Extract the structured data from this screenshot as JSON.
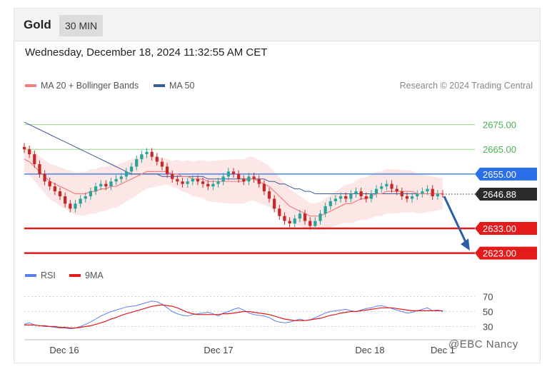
{
  "header": {
    "asset": "Gold",
    "timeframe": "30 MIN"
  },
  "datetime": "Wednesday, December 18, 2024 11:32:55 AM CET",
  "legend": {
    "ma20_label": "MA 20 + Bollinger Bands",
    "ma50_label": "MA 50"
  },
  "credit": "Research © 2024 Trading Central",
  "rsi_legend": {
    "rsi_label": "RSI",
    "ma9_label": "9MA"
  },
  "watermark": "@EBC Nancy",
  "colors": {
    "up": "#26a69a",
    "down": "#c62828",
    "ma20": "#f08080",
    "band": "#fcd5d5",
    "ma50": "#3d5a99",
    "green_level": "#9ad58a",
    "blue_level": "#2a6ee8",
    "red_level": "#e31b1b",
    "price_tag": "#2b2b2b",
    "rsi": "#5b7ff0",
    "rsi_ma": "#e31b1b",
    "arrow": "#2e5ea8"
  },
  "chart_data": [
    {
      "type": "candlestick",
      "title": "Gold",
      "x_ticks": [
        "Dec 16",
        "Dec 17",
        "Dec 18",
        "Dec 1"
      ],
      "y_range": [
        2620,
        2685
      ],
      "last_price": 2646.88,
      "levels": [
        {
          "value": 2675.0,
          "label": "2675.00",
          "kind": "resistance-green"
        },
        {
          "value": 2665.0,
          "label": "2665.00",
          "kind": "resistance-green"
        },
        {
          "value": 2655.0,
          "label": "2655.00",
          "kind": "pivot-blue"
        },
        {
          "value": 2633.0,
          "label": "2633.00",
          "kind": "target-red"
        },
        {
          "value": 2623.0,
          "label": "2623.00",
          "kind": "target-red"
        }
      ],
      "last_price_label": "2646.88",
      "close_series": [
        2665,
        2663,
        2659,
        2655,
        2652,
        2650,
        2648,
        2646,
        2643,
        2641,
        2643,
        2645,
        2646,
        2648,
        2650,
        2651,
        2650,
        2652,
        2653,
        2654,
        2656,
        2658,
        2661,
        2663,
        2664,
        2662,
        2660,
        2658,
        2655,
        2653,
        2652,
        2651,
        2652,
        2653,
        2652,
        2651,
        2650,
        2651,
        2652,
        2654,
        2656,
        2655,
        2653,
        2652,
        2654,
        2653,
        2651,
        2648,
        2645,
        2641,
        2638,
        2636,
        2635,
        2637,
        2639,
        2636,
        2634,
        2636,
        2639,
        2642,
        2644,
        2645,
        2646,
        2645,
        2647,
        2648,
        2646,
        2645,
        2647,
        2649,
        2650,
        2651,
        2649,
        2648,
        2646,
        2645,
        2646,
        2647,
        2648,
        2649,
        2646,
        2647,
        2646.88
      ],
      "ma20_series": [
        2661,
        2660,
        2658,
        2656,
        2654,
        2652,
        2651,
        2650,
        2649,
        2648,
        2647,
        2647,
        2647,
        2648,
        2648,
        2649,
        2649,
        2650,
        2650,
        2651,
        2652,
        2653,
        2654,
        2655,
        2656,
        2656,
        2656,
        2656,
        2656,
        2655,
        2655,
        2654,
        2654,
        2653,
        2653,
        2653,
        2652,
        2652,
        2652,
        2652,
        2652,
        2652,
        2652,
        2652,
        2653,
        2653,
        2652,
        2651,
        2650,
        2648,
        2646,
        2644,
        2642,
        2641,
        2640,
        2639,
        2638,
        2638,
        2638,
        2639,
        2640,
        2641,
        2642,
        2643,
        2643,
        2644,
        2645,
        2645,
        2646,
        2647,
        2647,
        2648,
        2648,
        2648,
        2648,
        2648,
        2648,
        2647,
        2647,
        2647,
        2647,
        2647,
        2647
      ],
      "ma50_series": [
        2676,
        2675,
        2674,
        2673,
        2672,
        2671,
        2670,
        2669,
        2668,
        2667,
        2666,
        2665,
        2664,
        2663,
        2662,
        2661,
        2660,
        2659,
        2658,
        2657,
        2656,
        2655,
        2655,
        2655,
        2655,
        2655,
        2655,
        2654,
        2654,
        2654,
        2654,
        2654,
        2654,
        2654,
        2654,
        2654,
        2653,
        2653,
        2653,
        2653,
        2653,
        2653,
        2653,
        2653,
        2653,
        2653,
        2653,
        2653,
        2652,
        2652,
        2651,
        2651,
        2650,
        2649,
        2649,
        2648,
        2648,
        2647,
        2647,
        2647,
        2647,
        2647,
        2647,
        2647,
        2647,
        2647,
        2647,
        2647,
        2647,
        2647,
        2647,
        2647,
        2647,
        2647,
        2647,
        2647,
        2647,
        2647,
        2647,
        2647,
        2647,
        2647,
        2647
      ]
    },
    {
      "type": "line",
      "title": "RSI",
      "y_ticks": [
        "70",
        "50",
        "30"
      ],
      "y_range": [
        20,
        80
      ],
      "series": [
        {
          "name": "RSI",
          "values": [
            33,
            35,
            32,
            31,
            30,
            30,
            29,
            28,
            28,
            27,
            28,
            30,
            33,
            36,
            40,
            44,
            47,
            50,
            52,
            54,
            56,
            57,
            58,
            60,
            62,
            64,
            63,
            60,
            55,
            50,
            47,
            45,
            44,
            46,
            47,
            48,
            49,
            47,
            44,
            48,
            50,
            53,
            55,
            52,
            48,
            46,
            45,
            44,
            42,
            38,
            36,
            35,
            36,
            38,
            40,
            38,
            39,
            42,
            45,
            48,
            50,
            51,
            52,
            53,
            51,
            50,
            52,
            54,
            55,
            57,
            58,
            56,
            54,
            52,
            50,
            48,
            49,
            51,
            53,
            55,
            51,
            52,
            50
          ]
        },
        {
          "name": "9MA",
          "values": [
            32,
            32,
            32,
            31,
            31,
            30,
            30,
            29,
            29,
            28,
            28,
            29,
            30,
            31,
            33,
            35,
            37,
            40,
            42,
            45,
            47,
            49,
            51,
            53,
            55,
            57,
            58,
            59,
            58,
            57,
            55,
            52,
            49,
            47,
            46,
            46,
            46,
            46,
            46,
            47,
            47,
            48,
            49,
            50,
            50,
            49,
            48,
            47,
            46,
            44,
            42,
            40,
            39,
            38,
            38,
            38,
            39,
            40,
            41,
            43,
            45,
            46,
            48,
            49,
            50,
            50,
            51,
            52,
            53,
            54,
            55,
            55,
            55,
            54,
            53,
            52,
            51,
            51,
            51,
            51,
            51,
            51,
            51
          ]
        }
      ]
    }
  ]
}
